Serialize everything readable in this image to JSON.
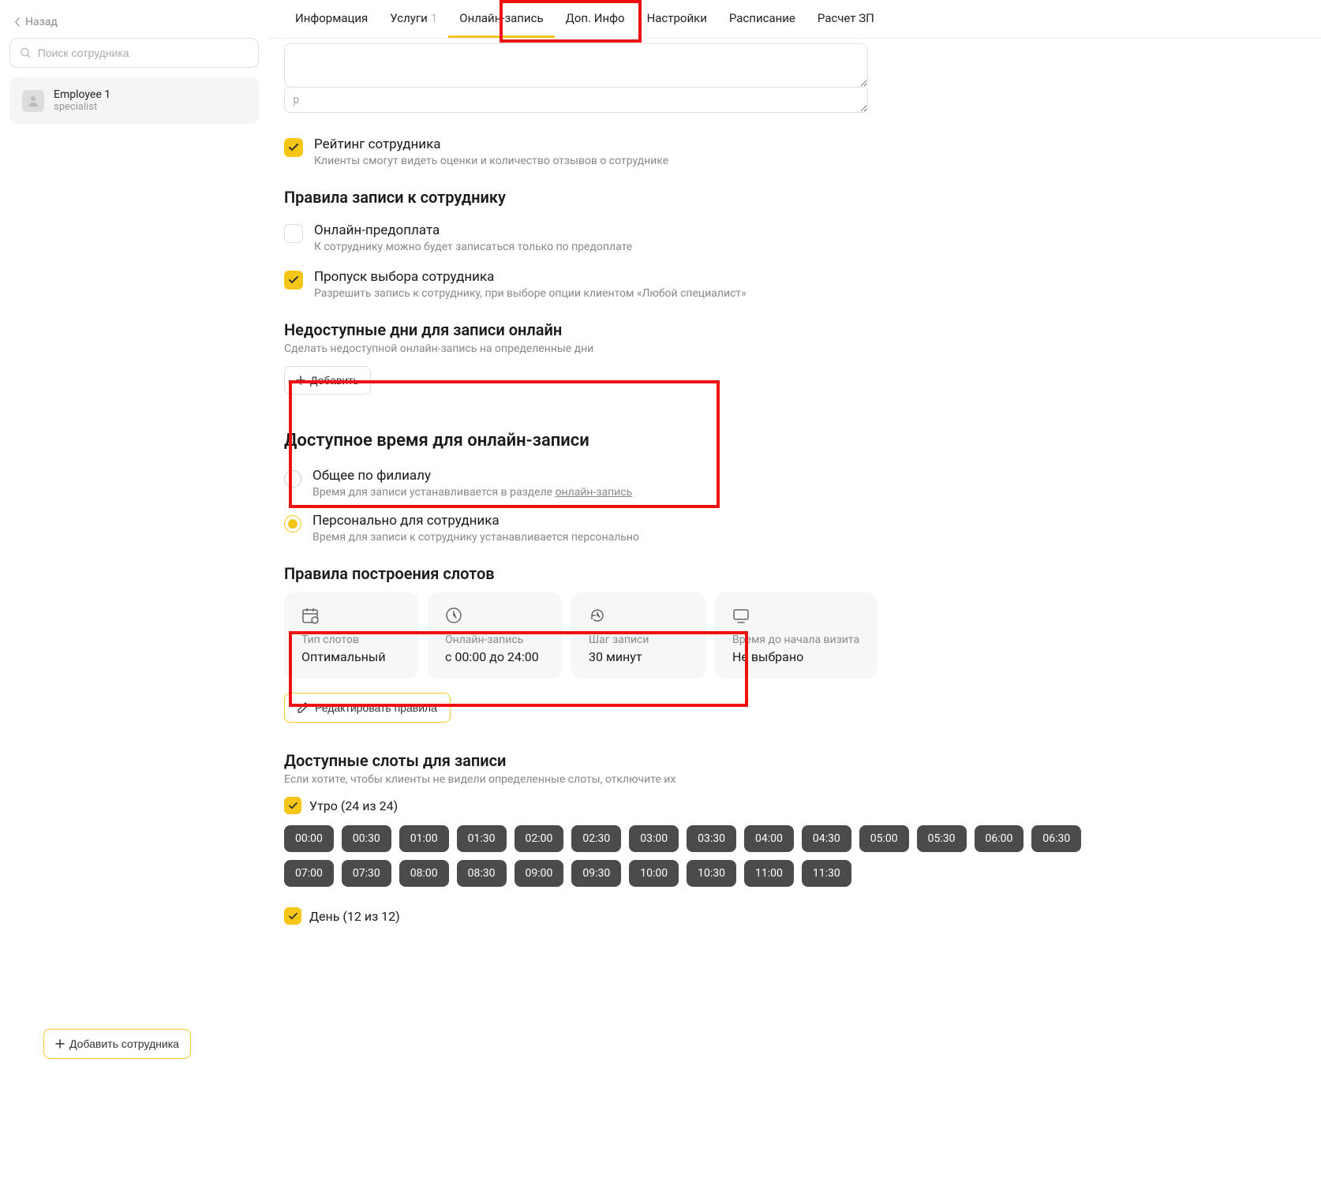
{
  "sidebar": {
    "back": "Назад",
    "search_placeholder": "Поиск сотрудника",
    "employee": {
      "name": "Employee 1",
      "role": "specialist"
    },
    "add_employee": "Добавить сотрудника"
  },
  "tabs": [
    {
      "label": "Информация"
    },
    {
      "label": "Услуги",
      "count": "1"
    },
    {
      "label": "Онлайн-запись",
      "active": true
    },
    {
      "label": "Доп. Инфо"
    },
    {
      "label": "Настройки"
    },
    {
      "label": "Расписание"
    },
    {
      "label": "Расчет ЗП"
    }
  ],
  "textarea_p": "p",
  "rating": {
    "label": "Рейтинг сотрудника",
    "desc": "Клиенты смогут видеть оценки и количество отзывов о сотруднике"
  },
  "rules_title": "Правила записи к сотруднику",
  "prepay": {
    "label": "Онлайн-предоплата",
    "desc": "К сотруднику можно будет записаться только по предоплате"
  },
  "skip": {
    "label": "Пропуск выбора сотрудника",
    "desc": "Разрешить запись к сотруднику, при выборе опции клиентом «Любой специалист»"
  },
  "unavailable": {
    "title": "Недоступные дни для записи онлайн",
    "sub": "Сделать недоступной онлайн-запись на определенные дни",
    "add": "Добавить"
  },
  "available_time": {
    "title": "Доступное время для онлайн-записи",
    "general": {
      "label": "Общее по филиалу",
      "desc_prefix": "Время для записи устанавливается в разделе ",
      "desc_link": "онлайн-запись"
    },
    "personal": {
      "label": "Персонально для сотрудника",
      "desc": "Время для записи к сотруднику устанавливается персонально"
    }
  },
  "slot_rules": {
    "title": "Правила построения слотов",
    "cards": {
      "type": {
        "k": "Тип слотов",
        "v": "Оптимальный"
      },
      "range": {
        "k": "Онлайн-запись",
        "v": "с 00:00 до 24:00"
      },
      "step": {
        "k": "Шаг записи",
        "v": "30 минут"
      },
      "before": {
        "k": "Время до начала визита",
        "v": "Не выбрано"
      }
    },
    "edit": "Редактировать правила"
  },
  "avail_slots": {
    "title": "Доступные слоты для записи",
    "sub": "Если хотите, чтобы клиенты не видели определенные слоты, отключите их",
    "morning_label": "Утро (24 из 24)",
    "morning": [
      "00:00",
      "00:30",
      "01:00",
      "01:30",
      "02:00",
      "02:30",
      "03:00",
      "03:30",
      "04:00",
      "04:30",
      "05:00",
      "05:30",
      "06:00",
      "06:30",
      "07:00",
      "07:30",
      "08:00",
      "08:30",
      "09:00",
      "09:30",
      "10:00",
      "10:30",
      "11:00",
      "11:30"
    ],
    "day_label": "День (12 из 12)"
  }
}
